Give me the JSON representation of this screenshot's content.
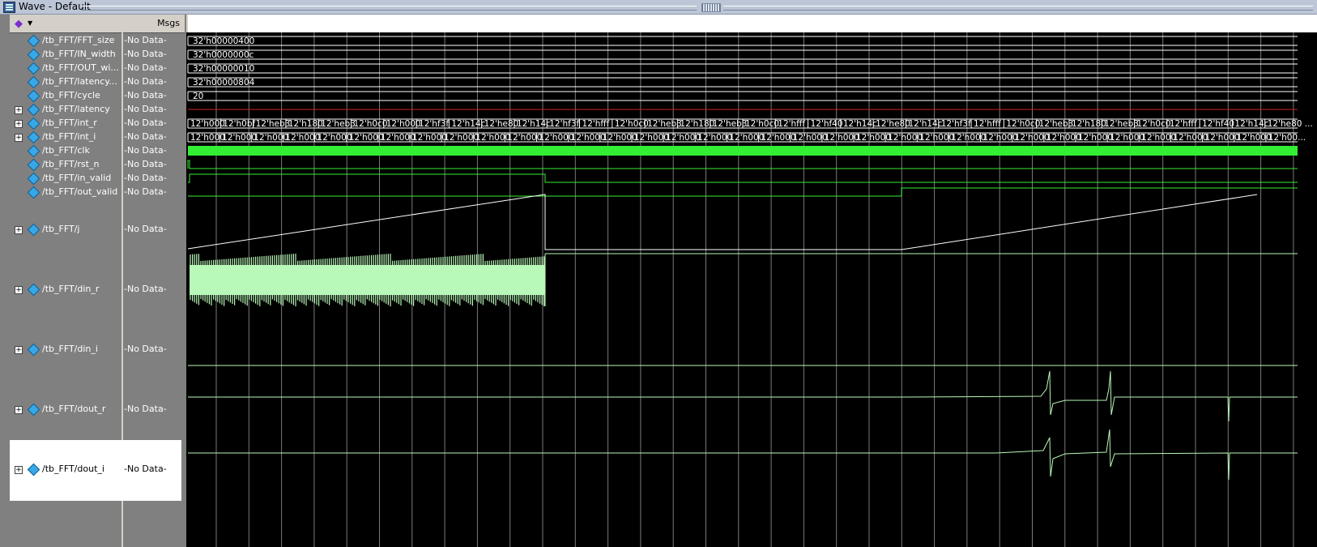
{
  "window": {
    "title": "Wave - Default"
  },
  "headers": {
    "msgs": "Msgs"
  },
  "signals": [
    {
      "name": "/tb_FFT/FFT_size",
      "msg": "-No Data-",
      "value": "32'h00000400",
      "expandable": false
    },
    {
      "name": "/tb_FFT/IN_width",
      "msg": "-No Data-",
      "value": "32'h0000000c",
      "expandable": false
    },
    {
      "name": "/tb_FFT/OUT_wi...",
      "msg": "-No Data-",
      "value": "32'h00000010",
      "expandable": false
    },
    {
      "name": "/tb_FFT/latency...",
      "msg": "-No Data-",
      "value": "32'h00000804",
      "expandable": false
    },
    {
      "name": "/tb_FFT/cycle",
      "msg": "-No Data-",
      "value": "20",
      "expandable": false
    },
    {
      "name": "/tb_FFT/latency",
      "msg": "-No Data-",
      "value": "",
      "expandable": true
    },
    {
      "name": "/tb_FFT/int_r",
      "msg": "-No Data-",
      "value": "",
      "expandable": true
    },
    {
      "name": "/tb_FFT/int_i",
      "msg": "-No Data-",
      "value": "",
      "expandable": true
    },
    {
      "name": "/tb_FFT/clk",
      "msg": "-No Data-",
      "value": "",
      "expandable": false
    },
    {
      "name": "/tb_FFT/rst_n",
      "msg": "-No Data-",
      "value": "",
      "expandable": false
    },
    {
      "name": "/tb_FFT/in_valid",
      "msg": "-No Data-",
      "value": "",
      "expandable": false
    },
    {
      "name": "/tb_FFT/out_valid",
      "msg": "-No Data-",
      "value": "",
      "expandable": false
    },
    {
      "name": "/tb_FFT/j",
      "msg": "-No Data-",
      "value": "",
      "expandable": true
    },
    {
      "name": "/tb_FFT/din_r",
      "msg": "-No Data-",
      "value": "",
      "expandable": true
    },
    {
      "name": "/tb_FFT/din_i",
      "msg": "-No Data-",
      "value": "",
      "expandable": true
    },
    {
      "name": "/tb_FFT/dout_r",
      "msg": "-No Data-",
      "value": "",
      "expandable": true
    },
    {
      "name": "/tb_FFT/dout_i",
      "msg": "-No Data-",
      "value": "",
      "expandable": true
    }
  ],
  "bus_values": {
    "int_r": [
      "12'h000",
      "12'h0bf",
      "12'heb3",
      "12'h180",
      "12'heb3",
      "12'h0c0",
      "12'h000",
      "12'hf3f",
      "12'h14c",
      "12'he80",
      "12'h14c",
      "12'hf3f",
      "12'hfff",
      "12'h0c0",
      "12'heb3",
      "12'h180",
      "12'heb3",
      "12'h0c0",
      "12'hfff",
      "12'hf40",
      "12'h14c",
      "12'he80",
      "12'h14c",
      "12'hf3f",
      "12'hfff",
      "12'h0c0",
      "12'heb3",
      "12'h180",
      "12'heb3",
      "12'h0c0",
      "12'hfff",
      "12'hf40",
      "12'h14c",
      "12'he80 ..."
    ],
    "int_i": [
      "12'h000",
      "12'h000",
      "12'h000",
      "12'h000",
      "12'h000",
      "12'h000",
      "12'h000",
      "12'h000",
      "12'h000",
      "12'h000",
      "12'h000",
      "12'h000",
      "12'h000",
      "12'h000",
      "12'h000",
      "12'h000",
      "12'h000",
      "12'h000",
      "12'h000",
      "12'h000",
      "12'h000",
      "12'h000",
      "12'h000",
      "12'h000",
      "12'h000",
      "12'h000",
      "12'h000",
      "12'h000",
      "12'h000",
      "12'h000",
      "12'h000",
      "12'h000",
      "12'h000",
      "12'h000",
      "12'h00..."
    ]
  },
  "colors": {
    "wave_green": "#33ee33",
    "wave_pale": "#b8f8b8",
    "latency_red": "#cc2222",
    "grid": "#7a7a7a",
    "icon_blue": "#39a7e6"
  }
}
